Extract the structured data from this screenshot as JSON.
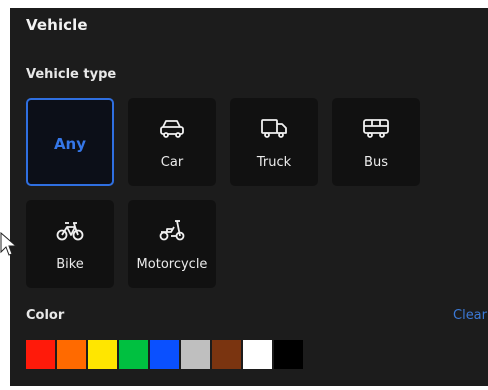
{
  "panel": {
    "title": "Vehicle",
    "vehicle_type_label": "Vehicle type",
    "color_label": "Color",
    "clear_label": "Clear"
  },
  "vehicle_types": {
    "any": "Any",
    "car": "Car",
    "truck": "Truck",
    "bus": "Bus",
    "bike": "Bike",
    "motorcycle": "Motorcycle"
  },
  "selected_type": "Any",
  "icons": {
    "car": "car-icon",
    "truck": "truck-icon",
    "bus": "bus-icon",
    "bike": "bike-icon",
    "motorcycle": "motorcycle-icon"
  },
  "colors": [
    "#ff1a0a",
    "#ff6a00",
    "#ffe600",
    "#00c040",
    "#0a50ff",
    "#bfbfbf",
    "#7a3410",
    "#ffffff",
    "#000000"
  ],
  "theme": {
    "accent": "#3577e8",
    "panel_bg": "#1c1c1c",
    "tile_bg": "#111111"
  }
}
